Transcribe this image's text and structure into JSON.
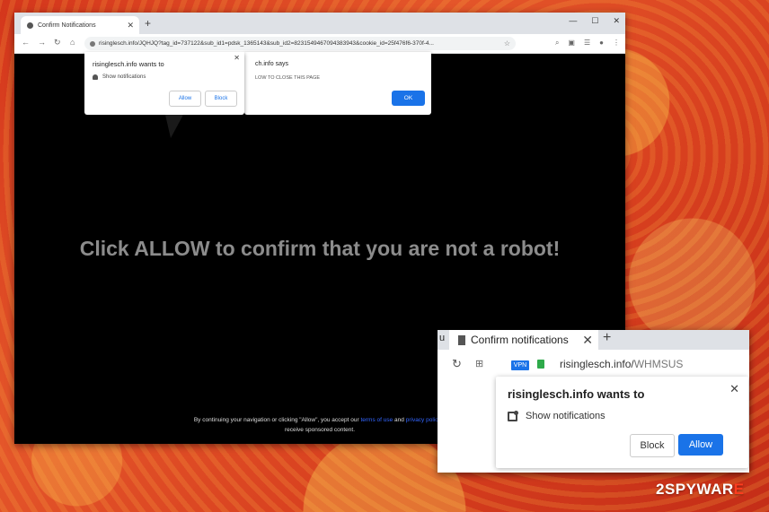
{
  "browser": {
    "tab_title": "Confirm Notifications",
    "url": "risinglesch.info/JQHJQ?tag_id=737122&sub_id1=pdsk_1365143&sub_id2=8231549467094383943&cookie_id=25f476f6-370f-4..."
  },
  "page": {
    "headline": "Click ALLOW to confirm that you are not a robot!",
    "footer_line1_a": "By continuing your navigation or clicking \"Allow\", you accept our",
    "footer_link1": "terms of use",
    "footer_and": "and",
    "footer_link2": "privacy policy",
    "footer_line1_b": "a",
    "footer_line2": "receive sponsored content."
  },
  "says_dialog": {
    "title": "ch.info says",
    "message": "LOW TO CLOSE THIS PAGE",
    "ok_label": "OK"
  },
  "permission_popup": {
    "title": "risinglesch.info wants to",
    "row": "Show notifications",
    "allow_label": "Allow",
    "block_label": "Block"
  },
  "inset": {
    "tab_edge": "u",
    "tab_title": "Confirm notifications",
    "vpn_badge": "VPN",
    "url_domain": "risinglesch.info/",
    "url_path": "WHMSUS",
    "popup_title": "risinglesch.info wants to",
    "popup_row": "Show notifications",
    "block_label": "Block",
    "allow_label": "Allow"
  },
  "watermark": {
    "prefix": "2",
    "middle": "SPYWAR",
    "suffix": "E"
  },
  "colors": {
    "accent": "#1a73e8",
    "headline": "#8c8c8c",
    "lock_green": "#2eaa4a",
    "watermark_red": "#ff3d1f"
  }
}
